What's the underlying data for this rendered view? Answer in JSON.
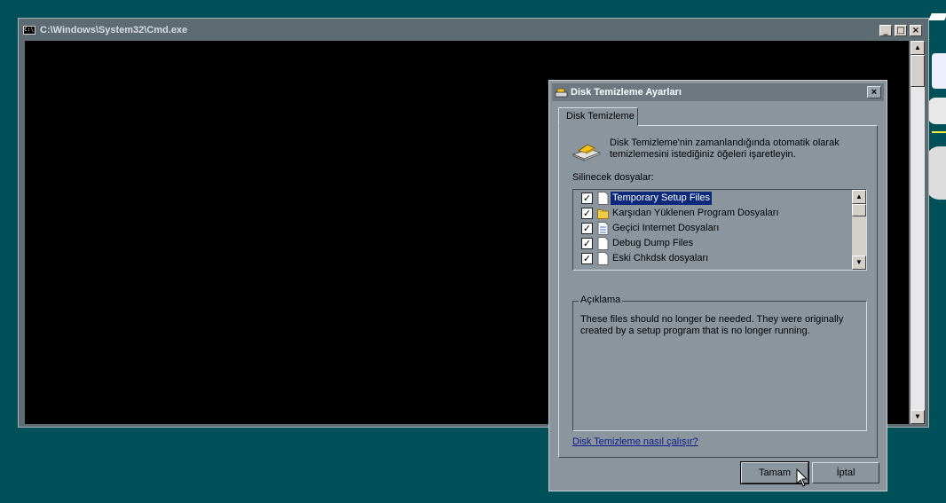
{
  "cmd_window": {
    "title": "C:\\Windows\\System32\\Cmd.exe",
    "icon_text": "C:\\",
    "controls": {
      "minimize": "_",
      "maximize": "□",
      "close": "×"
    }
  },
  "dialog": {
    "title": "Disk Temizleme Ayarları",
    "close_glyph": "×",
    "tab_label": "Disk Temizleme",
    "intro_text": "Disk Temizleme'nin zamanlandığında otomatik olarak temizlemesini istediğiniz öğeleri işaretleyin.",
    "files_label": "Silinecek dosyalar:",
    "files": [
      {
        "label": "Temporary Setup Files",
        "checked": true,
        "selected": true,
        "icon": "blank-file-icon"
      },
      {
        "label": "Karşıdan Yüklenen Program Dosyaları",
        "checked": true,
        "selected": false,
        "icon": "folder-icon"
      },
      {
        "label": "Geçici Internet Dosyaları",
        "checked": true,
        "selected": false,
        "icon": "document-icon"
      },
      {
        "label": "Debug Dump Files",
        "checked": true,
        "selected": false,
        "icon": "blank-file-icon"
      },
      {
        "label": "Eski Chkdsk dosyaları",
        "checked": true,
        "selected": false,
        "icon": "blank-file-icon"
      }
    ],
    "check_glyph": "✓",
    "description_legend": "Açıklama",
    "description_text": "These files should no longer be needed. They were originally created by a setup program that is no longer running.",
    "help_link": "Disk Temizleme nasıl çalışır?",
    "ok_label": "Tamam",
    "cancel_label": "İptal"
  },
  "colors": {
    "desktop": "#00505a",
    "dialog_face": "#8b959d",
    "selection": "#0c2a7c",
    "link": "#0a1a8a"
  }
}
